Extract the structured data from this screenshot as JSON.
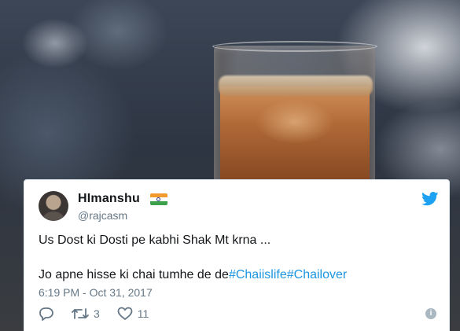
{
  "tweet": {
    "display_name": "HImanshu",
    "flag_icon": "india-flag-icon",
    "handle": "@rajcasm",
    "line1": "Us Dost ki Dosti pe kabhi Shak Mt krna ...",
    "line2_text": "Jo apne hisse ki chai tumhe de de",
    "hashtags": [
      "#Chaiislife",
      "#Chailover"
    ],
    "timestamp": "6:19 PM - Oct 31, 2017",
    "retweet_count": "3",
    "like_count": "11",
    "icons": {
      "brand": "twitter-bird-icon",
      "reply": "reply-icon",
      "retweet": "retweet-icon",
      "like": "heart-icon",
      "info": "info-icon"
    }
  },
  "colors": {
    "hashtag": "#1b95e0",
    "twitter_blue": "#1da1f2",
    "muted_text": "#657786",
    "primary_text": "#14171a"
  }
}
